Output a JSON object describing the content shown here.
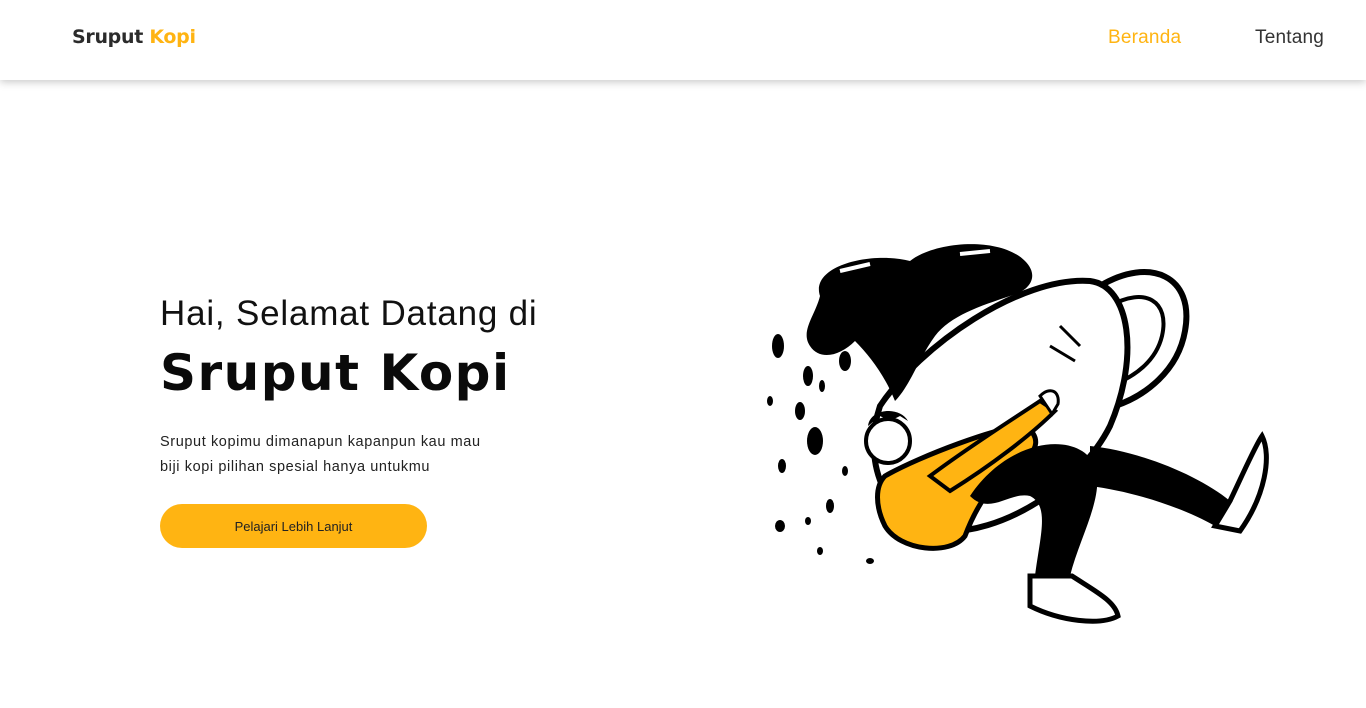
{
  "navbar": {
    "brand_primary": "Sruput",
    "brand_accent": "Kopi",
    "links": [
      {
        "label": "Beranda",
        "active": true
      },
      {
        "label": "Tentang",
        "active": false
      }
    ]
  },
  "hero": {
    "greeting": "Hai, Selamat Datang di",
    "title": "Sruput Kopi",
    "description_lines": [
      "Sruput kopimu dimanapun kapanpun kau mau",
      "biji kopi pilihan spesial hanya untukmu"
    ],
    "cta_label": "Pelajari Lebih Lanjut"
  },
  "illustration": {
    "icon": "coffee-cup-person-illustration"
  },
  "colors": {
    "accent": "#ffb412",
    "text_dark": "#111111",
    "nav_text": "#333333",
    "background": "#ffffff"
  }
}
